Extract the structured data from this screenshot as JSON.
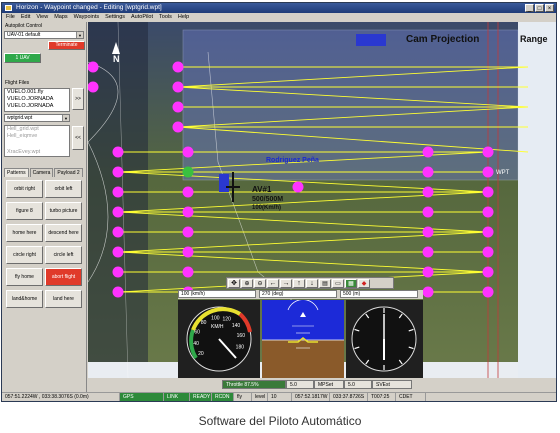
{
  "window": {
    "title": "Horizon  -  Waypoint changed - Editing [wptgrid.wpt]",
    "controls": [
      "_",
      "□",
      "×"
    ]
  },
  "menu": [
    "File",
    "Edit",
    "View",
    "Maps",
    "Waypoints",
    "Settings",
    "AutoPilot",
    "Tools",
    "Help"
  ],
  "left_panel": {
    "autopilot_label": "Autopilot Control",
    "autopilot_select": "UAV-01 default",
    "terminate_button": "Terminate",
    "uav_button": "1 UAV",
    "flight_files_label": "Flight Files",
    "flight_files": [
      "VUELO.001.fly",
      "VUELO.JORNADA",
      "VUELO.JORNADA"
    ],
    "nav_next": ">>",
    "nav_prev": "<<",
    "wpt_select": "wptgrid.wpt",
    "waypoint_sets": [
      "Hell_grid.wpt",
      "Hell_eiqmve",
      "XracEvey.wpt"
    ],
    "tabs": [
      "Patterns",
      "Camera",
      "Payload 2"
    ],
    "pattern_buttons": [
      [
        "orbit right",
        "orbit left"
      ],
      [
        "figure 8",
        "turbo picture"
      ],
      [
        "home here",
        "descend here"
      ],
      [
        "circle right",
        "circle left"
      ],
      [
        "fly home",
        "abort flight"
      ],
      [
        "land&home",
        "land here"
      ]
    ]
  },
  "map": {
    "cam_projection": "Cam Projection",
    "range_label": "Range",
    "north": "N",
    "aircraft_label": "AV#1",
    "aircraft_info": "500/500M",
    "aircraft_speed": "100(Km/h)",
    "place_label": "Rodriguez Peña",
    "wpt_label": "WPT"
  },
  "instruments": {
    "speed_field": "100 (km/h)",
    "heading_field": "270 (deg)",
    "alt_field": "500 (m)",
    "airspeed_unit": "KM/H",
    "airspeed_ticks": [
      "20",
      "40",
      "60",
      "80",
      "100",
      "120",
      "140",
      "160",
      "180"
    ]
  },
  "throttle": [
    "Throttle 87.5%",
    "5.0",
    "MPSet",
    "5.0",
    "SVEst"
  ],
  "status": [
    {
      "text": "057:51.2224W , 033:38.3076S  (0.0m)",
      "green": false
    },
    {
      "text": "GPS",
      "green": true
    },
    {
      "text": "LINK",
      "green": true
    },
    {
      "text": "READY",
      "green": true
    },
    {
      "text": "RCDN",
      "green": true
    },
    {
      "text": "fly",
      "green": false
    },
    {
      "text": "level",
      "green": false
    },
    {
      "text": "10",
      "green": false
    },
    {
      "text": "057:52.1817W",
      "green": false
    },
    {
      "text": "033:37.8726S",
      "green": false
    },
    {
      "text": "T007:25",
      "green": false
    },
    {
      "text": "CDET",
      "green": false
    }
  ],
  "caption": "Software del Piloto Automático",
  "colors": {
    "waypoint": "#ff33ff",
    "track": "#ffff33",
    "cam_box": "#6a78c8"
  }
}
